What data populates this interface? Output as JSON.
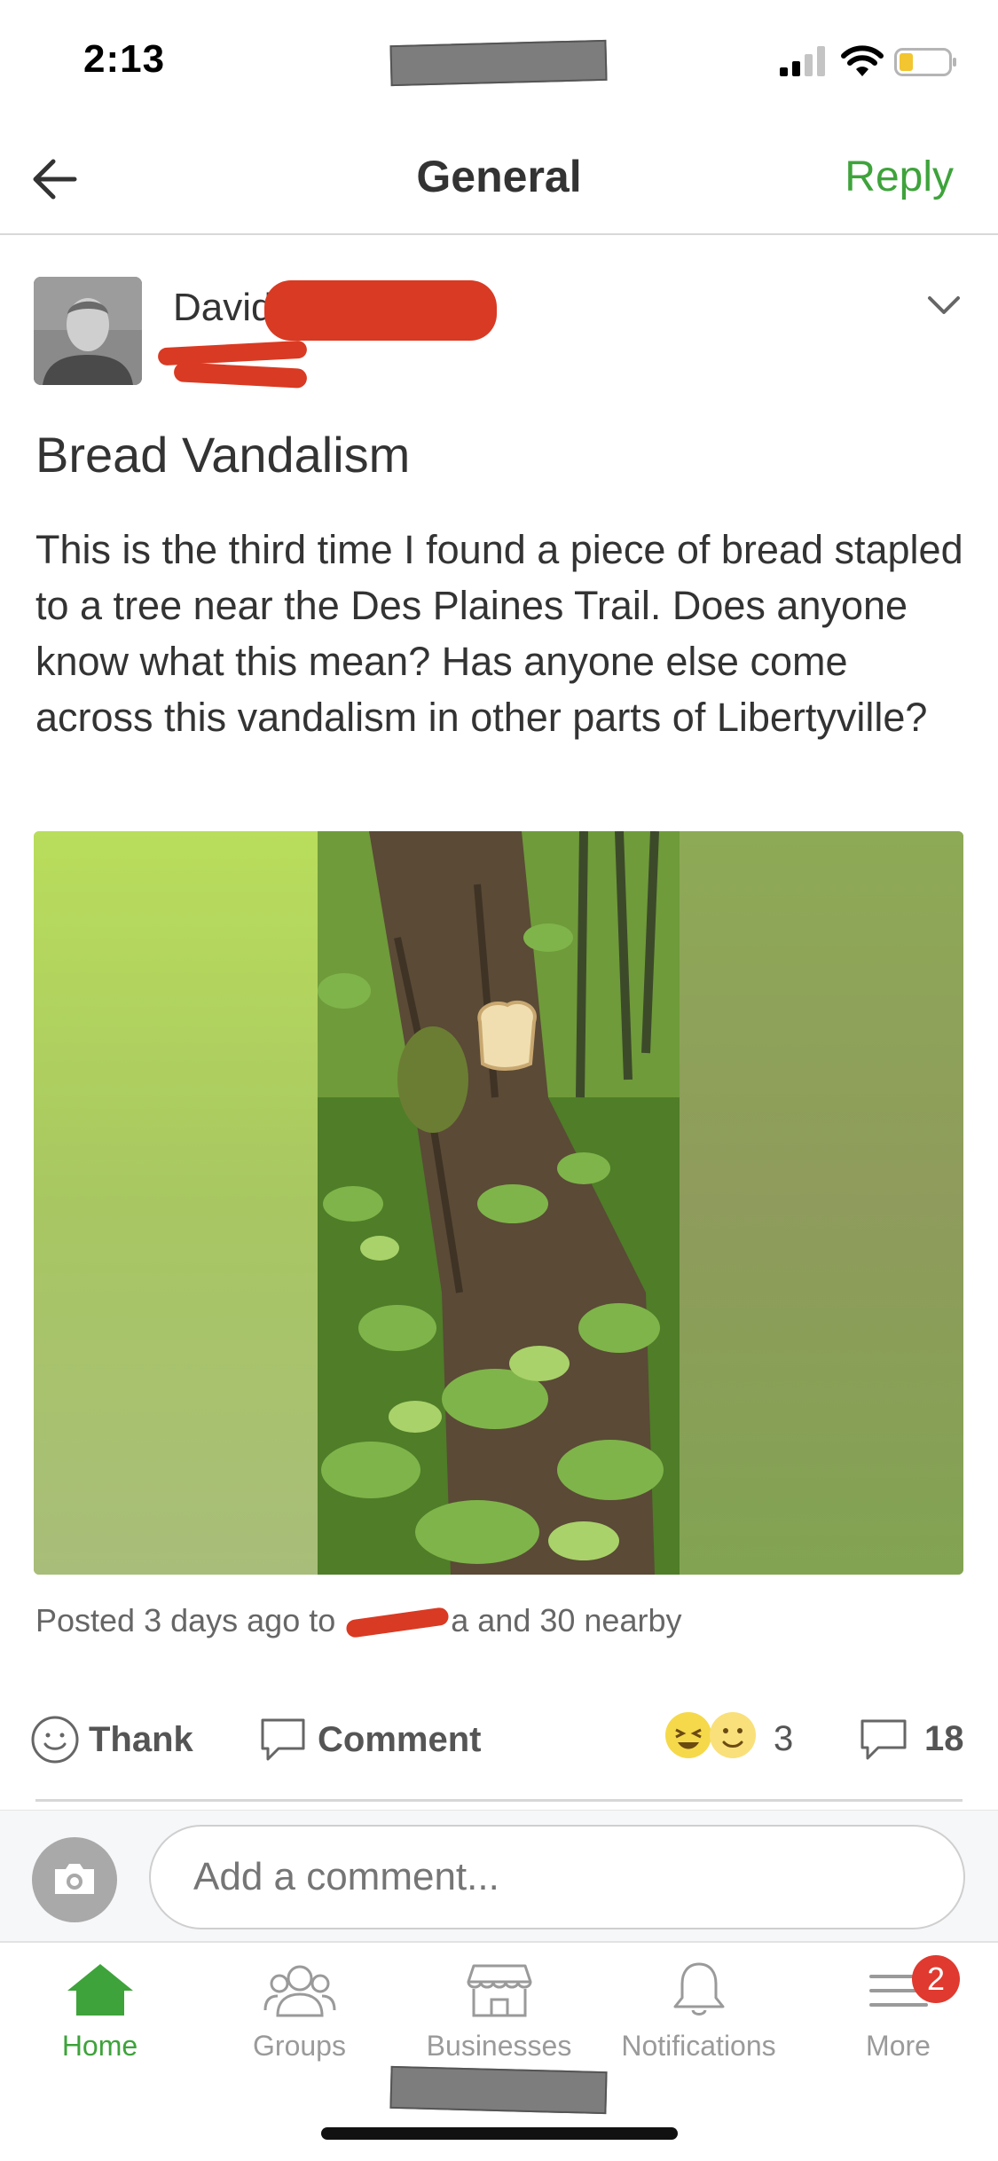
{
  "status_bar": {
    "time": "2:13"
  },
  "header": {
    "title": "General",
    "reply_label": "Reply"
  },
  "post": {
    "author_first_name": "David",
    "title": "Bread Vandalism",
    "body": "This is the third time I found a piece of bread stapled to a tree near the Des Plaines Trail. Does anyone know what this mean? Has anyone else come across this vandalism in other parts of Libertyville?",
    "posted_prefix": "Posted 3 days ago to",
    "posted_suffix": "a and 30 nearby"
  },
  "actions": {
    "thank_label": "Thank",
    "comment_label": "Comment",
    "reaction_count": "3",
    "comment_count": "18"
  },
  "comment_box": {
    "placeholder": "Add a comment..."
  },
  "tabs": [
    {
      "label": "Home",
      "icon": "home-icon",
      "active": true
    },
    {
      "label": "Groups",
      "icon": "groups-icon",
      "active": false
    },
    {
      "label": "Businesses",
      "icon": "store-icon",
      "active": false
    },
    {
      "label": "Notifications",
      "icon": "bell-icon",
      "active": false
    },
    {
      "label": "More",
      "icon": "menu-icon",
      "active": false,
      "badge": "2"
    }
  ],
  "colors": {
    "accent": "#3ea33b",
    "badge": "#e0392f",
    "redaction": "#d93a23"
  }
}
